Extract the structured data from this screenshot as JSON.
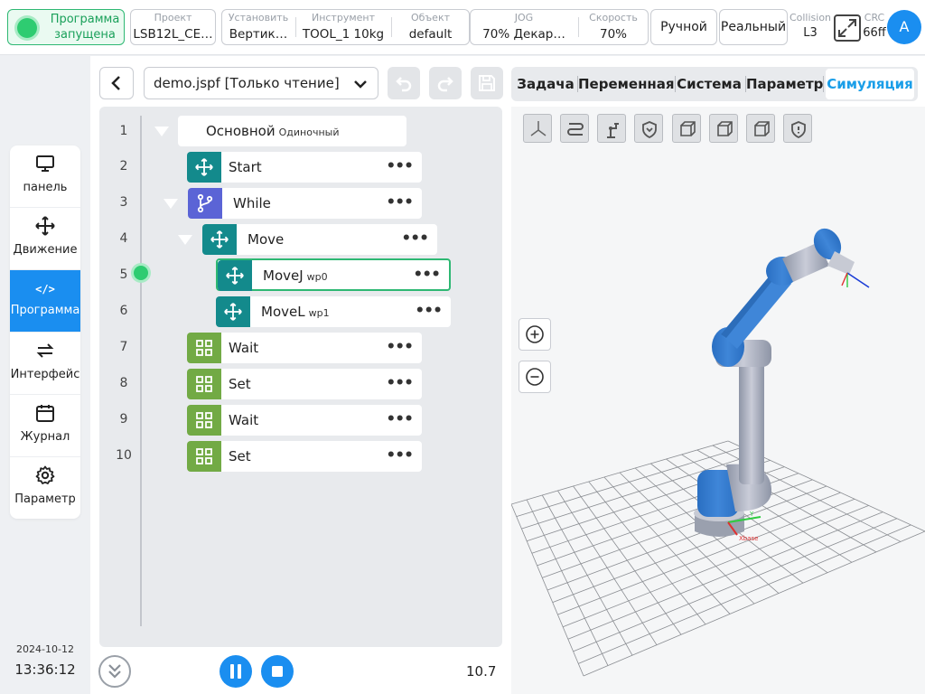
{
  "status": {
    "line1": "Программа",
    "line2": "запущена",
    "color": "#2ecc71"
  },
  "topbar": {
    "project": {
      "label": "Проект",
      "value": "LSB12L_CE…"
    },
    "install": {
      "label": "Установить",
      "value": "Вертик…"
    },
    "tool": {
      "label": "Инструмент",
      "value": "TOOL_1  10kg"
    },
    "object": {
      "label": "Объект",
      "value": "default"
    },
    "jog": {
      "label": "JOG",
      "value": "70%   Декар…"
    },
    "speed": {
      "label": "Скорость",
      "value": "70%"
    },
    "mode_manual": "Ручной",
    "mode_real": "Реальный",
    "collision": {
      "label": "Collision",
      "value": "L3"
    },
    "crc": {
      "label": "CRC",
      "value": "66ff"
    },
    "avatar_letter": "A"
  },
  "sidebar": {
    "items": [
      {
        "label": "панель",
        "icon": "monitor-icon"
      },
      {
        "label": "Движение",
        "icon": "move-arrows-icon"
      },
      {
        "label": "Программа",
        "icon": "code-icon",
        "code": "</>"
      },
      {
        "label": "Интерфейс",
        "icon": "swap-arrows-icon"
      },
      {
        "label": "Журнал",
        "icon": "calendar-icon"
      },
      {
        "label": "Параметр",
        "icon": "gear-icon"
      }
    ],
    "date": "2024-10-12",
    "time": "13:36:12"
  },
  "program": {
    "file": "demo.jspf [Только чтение]",
    "main_label": "Основной",
    "main_sub": "Одиночный",
    "line_numbers": [
      "1",
      "2",
      "3",
      "4",
      "5",
      "6",
      "7",
      "8",
      "9",
      "10"
    ],
    "nodes": [
      {
        "name": "Start",
        "sub": ""
      },
      {
        "name": "While",
        "sub": ""
      },
      {
        "name": "Move",
        "sub": ""
      },
      {
        "name": "MoveJ",
        "sub": "wp0"
      },
      {
        "name": "MoveL",
        "sub": "wp1"
      },
      {
        "name": "Wait",
        "sub": ""
      },
      {
        "name": "Set",
        "sub": ""
      },
      {
        "name": "Wait",
        "sub": ""
      },
      {
        "name": "Set",
        "sub": ""
      }
    ],
    "more": "•••",
    "speed_value": "10.7"
  },
  "colors": {
    "teal": "#138a8c",
    "purple": "#5b64d6",
    "green": "#72aa45",
    "blue": "#1a8ef0",
    "active_tab": "#1a9ee8"
  },
  "tabs": [
    {
      "label": "Задача"
    },
    {
      "label": "Переменная"
    },
    {
      "label": "Система"
    },
    {
      "label": "Параметр"
    },
    {
      "label": "Симуляция"
    }
  ],
  "sim_labels": {
    "x_axis": "Xbase",
    "y_axis": "Y"
  }
}
